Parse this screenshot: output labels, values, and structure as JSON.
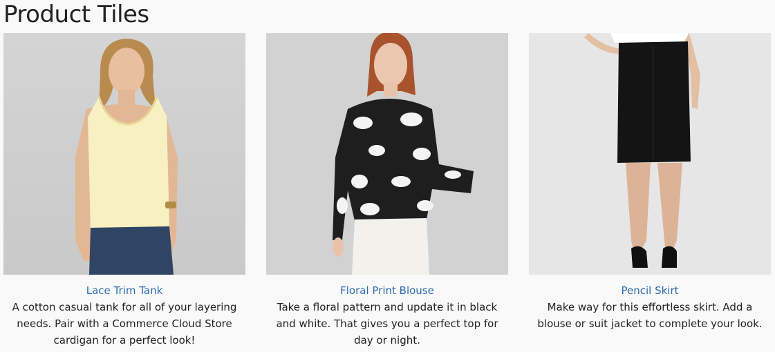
{
  "page": {
    "title": "Product Tiles"
  },
  "tiles": [
    {
      "name": "Lace Trim Tank",
      "description": "A cotton casual tank for all of your layering needs. Pair with a Commerce Cloud Store cardigan for a perfect look!"
    },
    {
      "name": "Floral Print Blouse",
      "description": "Take a floral pattern and update it in black and white. That gives you a perfect top for day or night."
    },
    {
      "name": "Pencil Skirt",
      "description": "Make way for this effortless skirt. Add a blouse or suit jacket to complete your look."
    }
  ],
  "colors": {
    "link": "#2b6cb0",
    "photo_background": "#d8d8d8",
    "page_background": "#f9f9f9"
  }
}
